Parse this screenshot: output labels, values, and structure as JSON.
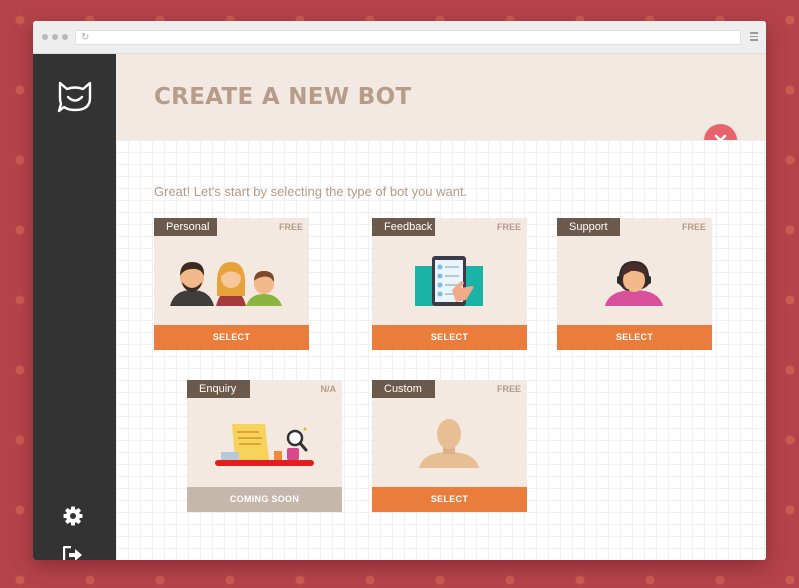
{
  "header": {
    "title": "CREATE A NEW BOT"
  },
  "main": {
    "subtitle": "Great! Let's start by selecting the type of bot you want.",
    "cards": [
      {
        "name": "Personal",
        "price": "FREE",
        "action": "SELECT",
        "enabled": true
      },
      {
        "name": "Feedback",
        "price": "FREE",
        "action": "SELECT",
        "enabled": true
      },
      {
        "name": "Support",
        "price": "FREE",
        "action": "SELECT",
        "enabled": true
      },
      {
        "name": "Enquiry",
        "price": "N/A",
        "action": "COMING SOON",
        "enabled": false
      },
      {
        "name": "Custom",
        "price": "FREE",
        "action": "SELECT",
        "enabled": true
      }
    ]
  },
  "sidebar": {
    "icons": [
      "chat-logo-icon",
      "gear-icon",
      "logout-icon"
    ]
  },
  "colors": {
    "background": "#b5424a",
    "sidebar": "#333333",
    "accent": "#ea7d3b",
    "close": "#e9636c",
    "title": "#b79c8a",
    "tag": "#6b5a4c",
    "disabled": "#c6b7ab"
  }
}
